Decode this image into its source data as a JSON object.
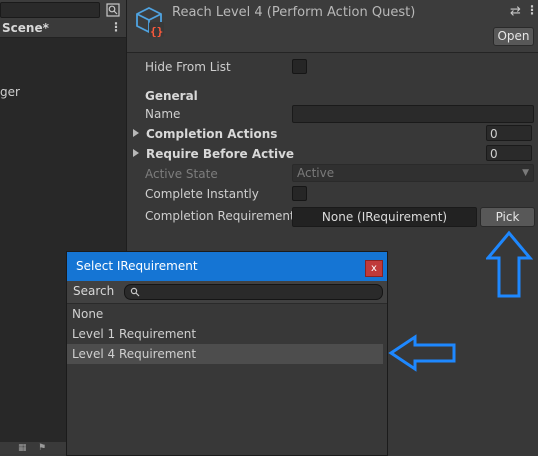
{
  "hierarchy": {
    "scene_label": "Scene*",
    "partial_item": "ger"
  },
  "inspector": {
    "title": "Reach Level 4 (Perform Action Quest)",
    "open_label": "Open",
    "hide_from_list_label": "Hide From List",
    "section_general": "General",
    "name_label": "Name",
    "name_value": "",
    "completion_actions_label": "Completion Actions",
    "completion_actions_count": "0",
    "require_before_active_label": "Require Before Active",
    "require_before_active_count": "0",
    "active_state_label": "Active State",
    "active_state_value": "Active",
    "complete_instantly_label": "Complete Instantly",
    "completion_requirement_label": "Completion Requirement",
    "completion_requirement_value": "None (IRequirement)",
    "pick_label": "Pick"
  },
  "popup": {
    "title": "Select IRequirement",
    "close_glyph": "x",
    "search_label": "Search",
    "search_value": "",
    "items": [
      {
        "label": "None"
      },
      {
        "label": "Level 1 Requirement"
      },
      {
        "label": "Level 4 Requirement",
        "selected": true
      }
    ]
  },
  "annotations": {
    "arrow_color": "#1e88ff"
  }
}
